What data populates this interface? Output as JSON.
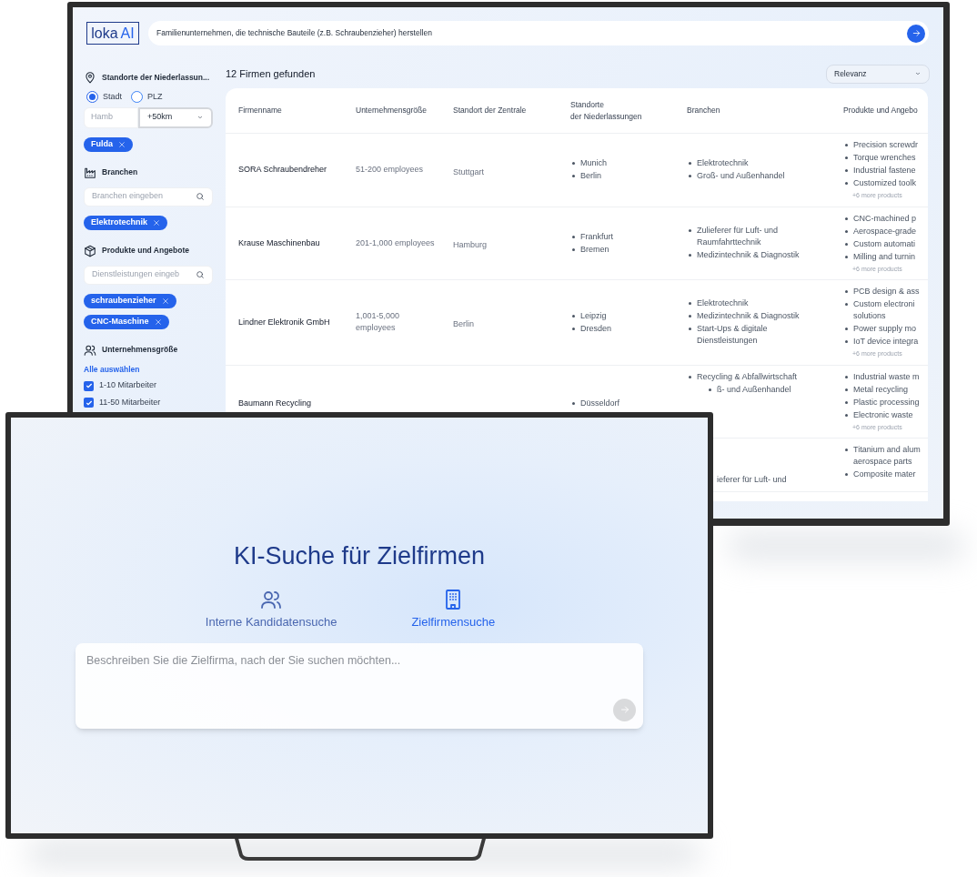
{
  "back_screen": {
    "logo": {
      "text": "loka",
      "accent": "AI"
    },
    "search": {
      "value": "Familienunternehmen, die technische Bauteile (z.B. Schraubenzieher) herstellen"
    },
    "filters": [
      {
        "kind": "location",
        "title": "Standorte der Niederlassun...",
        "options": [
          {
            "label": "Stadt",
            "selected": true
          },
          {
            "label": "PLZ",
            "selected": false
          }
        ],
        "city_value": "Hamb",
        "radius": "+50km",
        "chips": [
          "Fulda"
        ]
      },
      {
        "kind": "search",
        "title": "Branchen",
        "placeholder": "Branchen eingeben",
        "chips": [
          "Elektrotechnik"
        ]
      },
      {
        "kind": "search",
        "title": "Produkte und Angebote",
        "placeholder": "Dienstleistungen eingeb",
        "chips": [
          "schraubenzieher",
          "CNC-Maschine"
        ]
      },
      {
        "kind": "checklist",
        "title": "Unternehmensgröße",
        "select_all": "Alle auswählen",
        "items": [
          {
            "label": "1-10 Mitarbeiter",
            "checked": true
          },
          {
            "label": "11-50 Mitarbeiter",
            "checked": true
          }
        ]
      }
    ],
    "results_count": "12 Firmen gefunden",
    "sort": "Relevanz",
    "table": {
      "columns": [
        "Firmenname",
        "Unternehmensgröße",
        "Standort der Zentrale",
        "Standorte\nder Niederlassungen",
        "Branchen",
        "Produkte und Angebo"
      ],
      "rows": [
        {
          "name": "SORA Schraubendreher",
          "size": "51-200 employees",
          "hq": "Stuttgart",
          "locations": [
            "Munich",
            "Berlin"
          ],
          "industries": [
            "Elektrotechnik",
            "Groß- und Außenhandel"
          ],
          "products": [
            "Precision screwdr",
            "Torque wrenches",
            "Industrial fastene",
            "Customized toolk"
          ],
          "more": "+6 more products"
        },
        {
          "name": "Krause Maschinenbau",
          "size": "201-1,000 employees",
          "hq": "Hamburg",
          "locations": [
            "Frankfurt",
            "Bremen"
          ],
          "industries": [
            "Zulieferer für Luft- und Raumfahrttechnik",
            "Medizintechnik & Diagnostik"
          ],
          "products": [
            "CNC-machined p",
            "Aerospace-grade",
            "Custom automati",
            "Milling and turnin"
          ],
          "more": "+6 more products"
        },
        {
          "name": "Lindner Elektronik GmbH",
          "size": "1,001-5,000 employees",
          "hq": "Berlin",
          "locations": [
            "Leipzig",
            "Dresden"
          ],
          "industries": [
            "Elektrotechnik",
            "Medizintechnik & Diagnostik",
            "Start-Ups & digitale Dienstleistungen"
          ],
          "products": [
            "PCB design & ass",
            "Custom electroni\nsolutions",
            "Power supply mo",
            "IoT device integra"
          ],
          "more": "+6 more products"
        },
        {
          "name": "Baumann Recycling",
          "locations": [
            "Düsseldorf"
          ],
          "industries": [
            "Recycling & Abfallwirtschaft",
            "ß- und Außenhandel"
          ],
          "products": [
            "Industrial waste m",
            "Metal recycling",
            "Plastic processing",
            "Electronic waste"
          ],
          "more": "+6 more products"
        },
        {
          "industries": [
            "ieferer für Luft- und"
          ],
          "products": [
            "Titanium and alum\naerospace parts",
            "Composite mater"
          ]
        }
      ]
    }
  },
  "front_screen": {
    "title": "KI-Suche für Zielfirmen",
    "tabs": [
      {
        "label": "Interne Kandidatensuche",
        "selected": false
      },
      {
        "label": "Zielfirmensuche",
        "selected": true
      }
    ],
    "prompt": {
      "placeholder": "Beschreiben Sie die Zielfirma, nach der Sie suchen möchten..."
    }
  }
}
